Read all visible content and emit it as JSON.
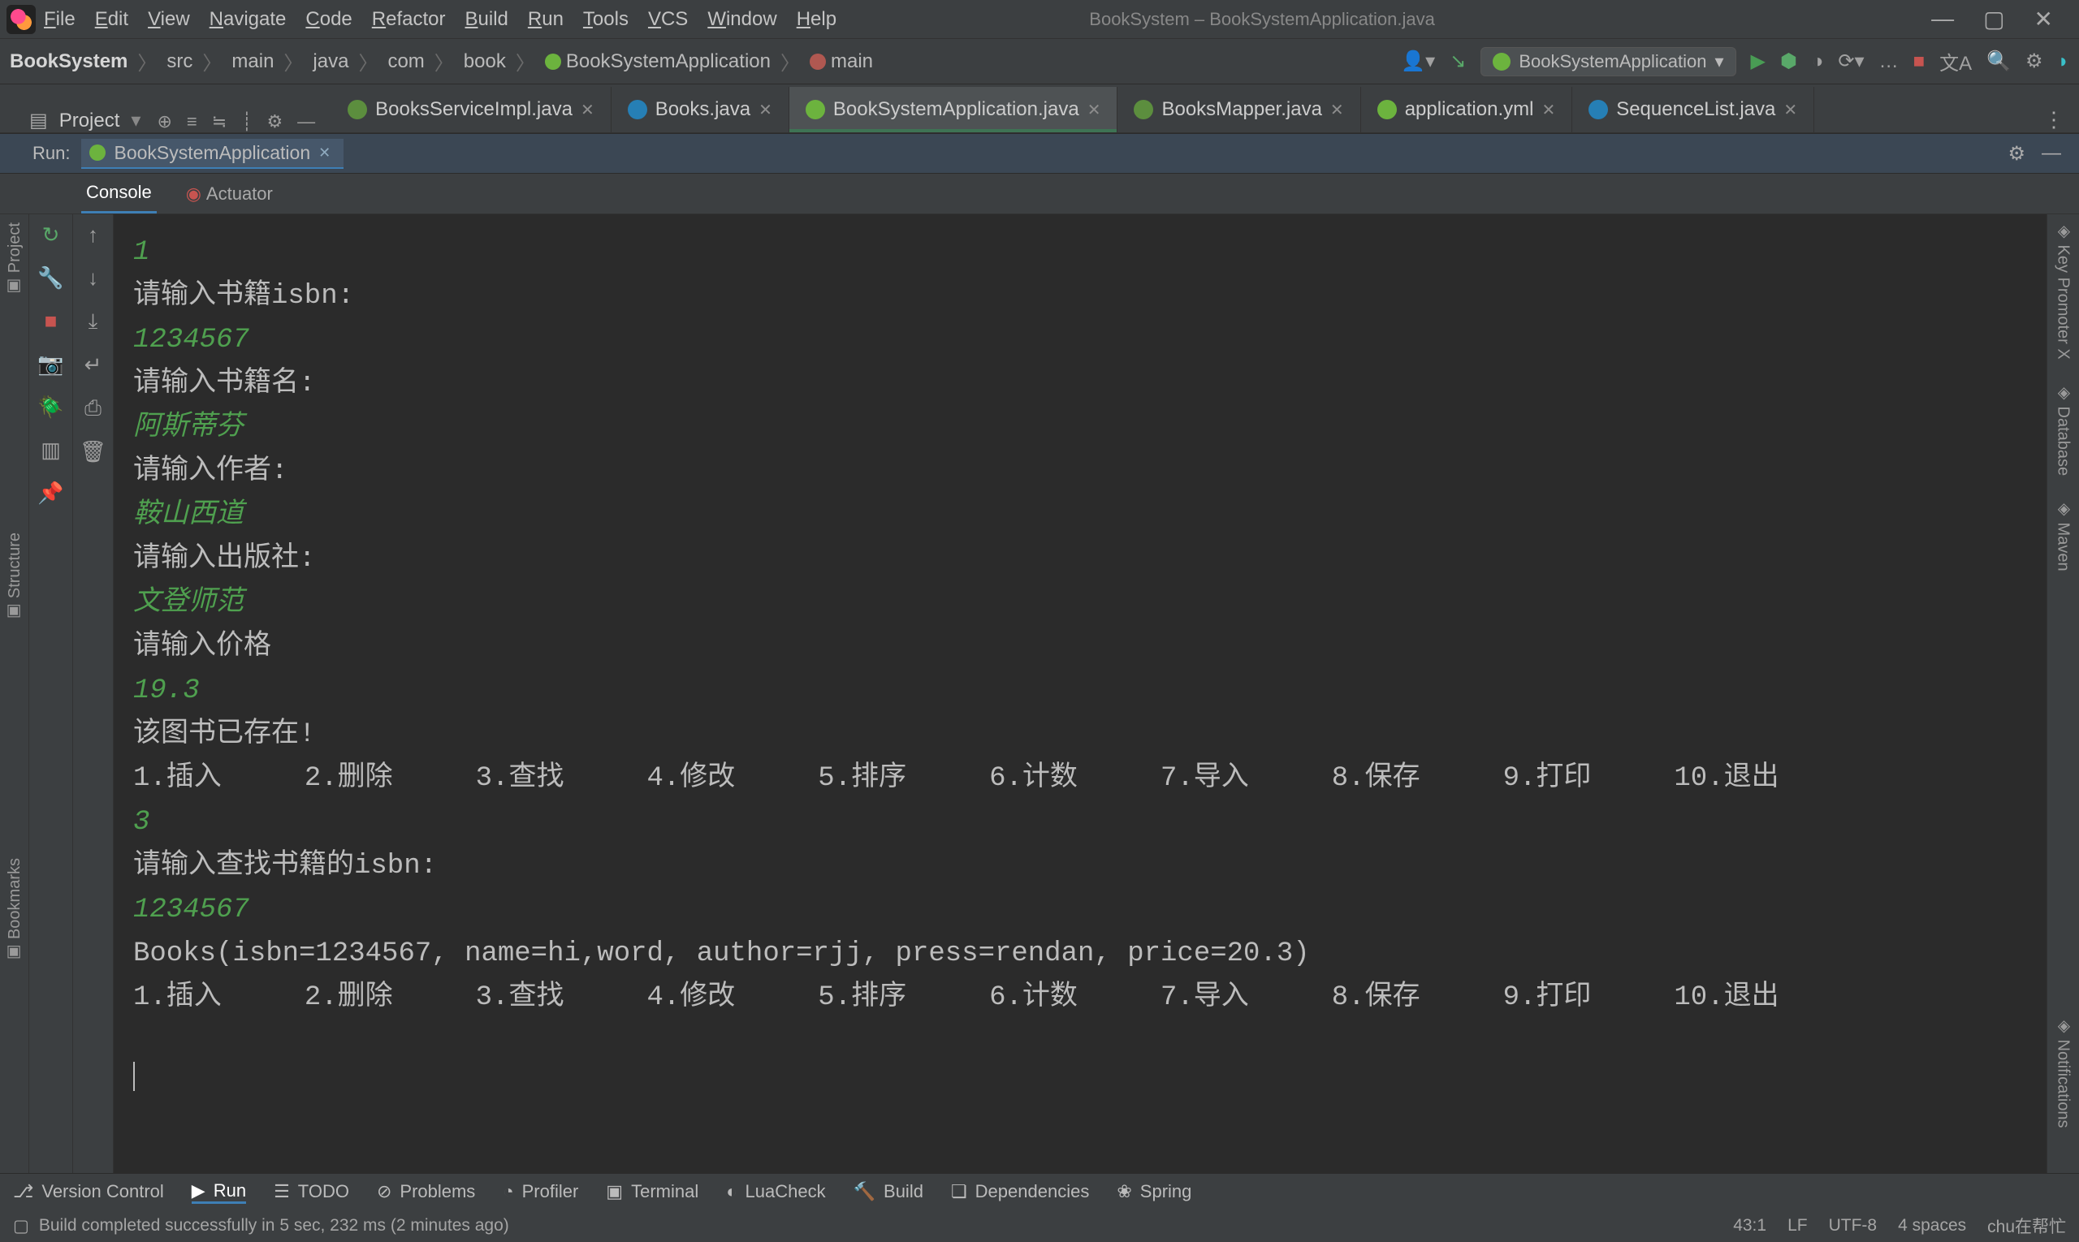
{
  "window": {
    "title": "BookSystem – BookSystemApplication.java"
  },
  "menubar": [
    "File",
    "Edit",
    "View",
    "Navigate",
    "Code",
    "Refactor",
    "Build",
    "Run",
    "Tools",
    "VCS",
    "Window",
    "Help"
  ],
  "breadcrumb": [
    "BookSystem",
    "src",
    "main",
    "java",
    "com",
    "book",
    "BookSystemApplication",
    "main"
  ],
  "run_config": "BookSystemApplication",
  "project_panel": {
    "label": "Project"
  },
  "editor_tabs": [
    {
      "label": "BooksServiceImpl.java",
      "kind": "ci"
    },
    {
      "label": "Books.java",
      "kind": "c"
    },
    {
      "label": "BookSystemApplication.java",
      "kind": "sb",
      "active": true
    },
    {
      "label": "BooksMapper.java",
      "kind": "ci"
    },
    {
      "label": "application.yml",
      "kind": "sb"
    },
    {
      "label": "SequenceList.java",
      "kind": "c"
    }
  ],
  "run_tab": {
    "label": "Run:",
    "app": "BookSystemApplication",
    "subtabs": [
      {
        "label": "Console",
        "active": true
      },
      {
        "label": "Actuator",
        "active": false
      }
    ]
  },
  "left_gutter": [
    "Project",
    "Structure",
    "Bookmarks"
  ],
  "right_gutter": [
    "Key Promoter X",
    "Database",
    "Maven",
    "Notifications"
  ],
  "bottom_tools": [
    "Version Control",
    "Run",
    "TODO",
    "Problems",
    "Profiler",
    "Terminal",
    "LuaCheck",
    "Build",
    "Dependencies",
    "Spring"
  ],
  "bottom_tools_active": "Run",
  "status_msg": "Build completed successfully in 5 sec, 232 ms (2 minutes ago)",
  "status_right": [
    "43:1",
    "LF",
    "UTF-8",
    "4 spaces",
    "chu在帮忙"
  ],
  "console": {
    "lines": [
      {
        "t": "",
        "cls": ""
      },
      {
        "t": "1",
        "cls": "in-green"
      },
      {
        "t": "请输入书籍isbn:",
        "cls": ""
      },
      {
        "t": "1234567",
        "cls": "in-green"
      },
      {
        "t": "请输入书籍名:",
        "cls": ""
      },
      {
        "t": "阿斯蒂芬",
        "cls": "in-it"
      },
      {
        "t": "请输入作者:",
        "cls": ""
      },
      {
        "t": "鞍山西道",
        "cls": "in-it"
      },
      {
        "t": "请输入出版社:",
        "cls": ""
      },
      {
        "t": "文登师范",
        "cls": "in-it"
      },
      {
        "t": "请输入价格",
        "cls": ""
      },
      {
        "t": "19.3",
        "cls": "in-green"
      },
      {
        "t": "该图书已存在!",
        "cls": ""
      },
      {
        "t": "1.插入     2.删除     3.查找     4.修改     5.排序     6.计数     7.导入     8.保存     9.打印     10.退出",
        "cls": ""
      },
      {
        "t": "",
        "cls": ""
      },
      {
        "t": "3",
        "cls": "in-green"
      },
      {
        "t": "请输入查找书籍的isbn:",
        "cls": ""
      },
      {
        "t": "1234567",
        "cls": "in-green"
      },
      {
        "t": "Books(isbn=1234567, name=hi,word, author=rjj, press=rendan, price=20.3)",
        "cls": ""
      },
      {
        "t": "1.插入     2.删除     3.查找     4.修改     5.排序     6.计数     7.导入     8.保存     9.打印     10.退出",
        "cls": ""
      }
    ]
  }
}
